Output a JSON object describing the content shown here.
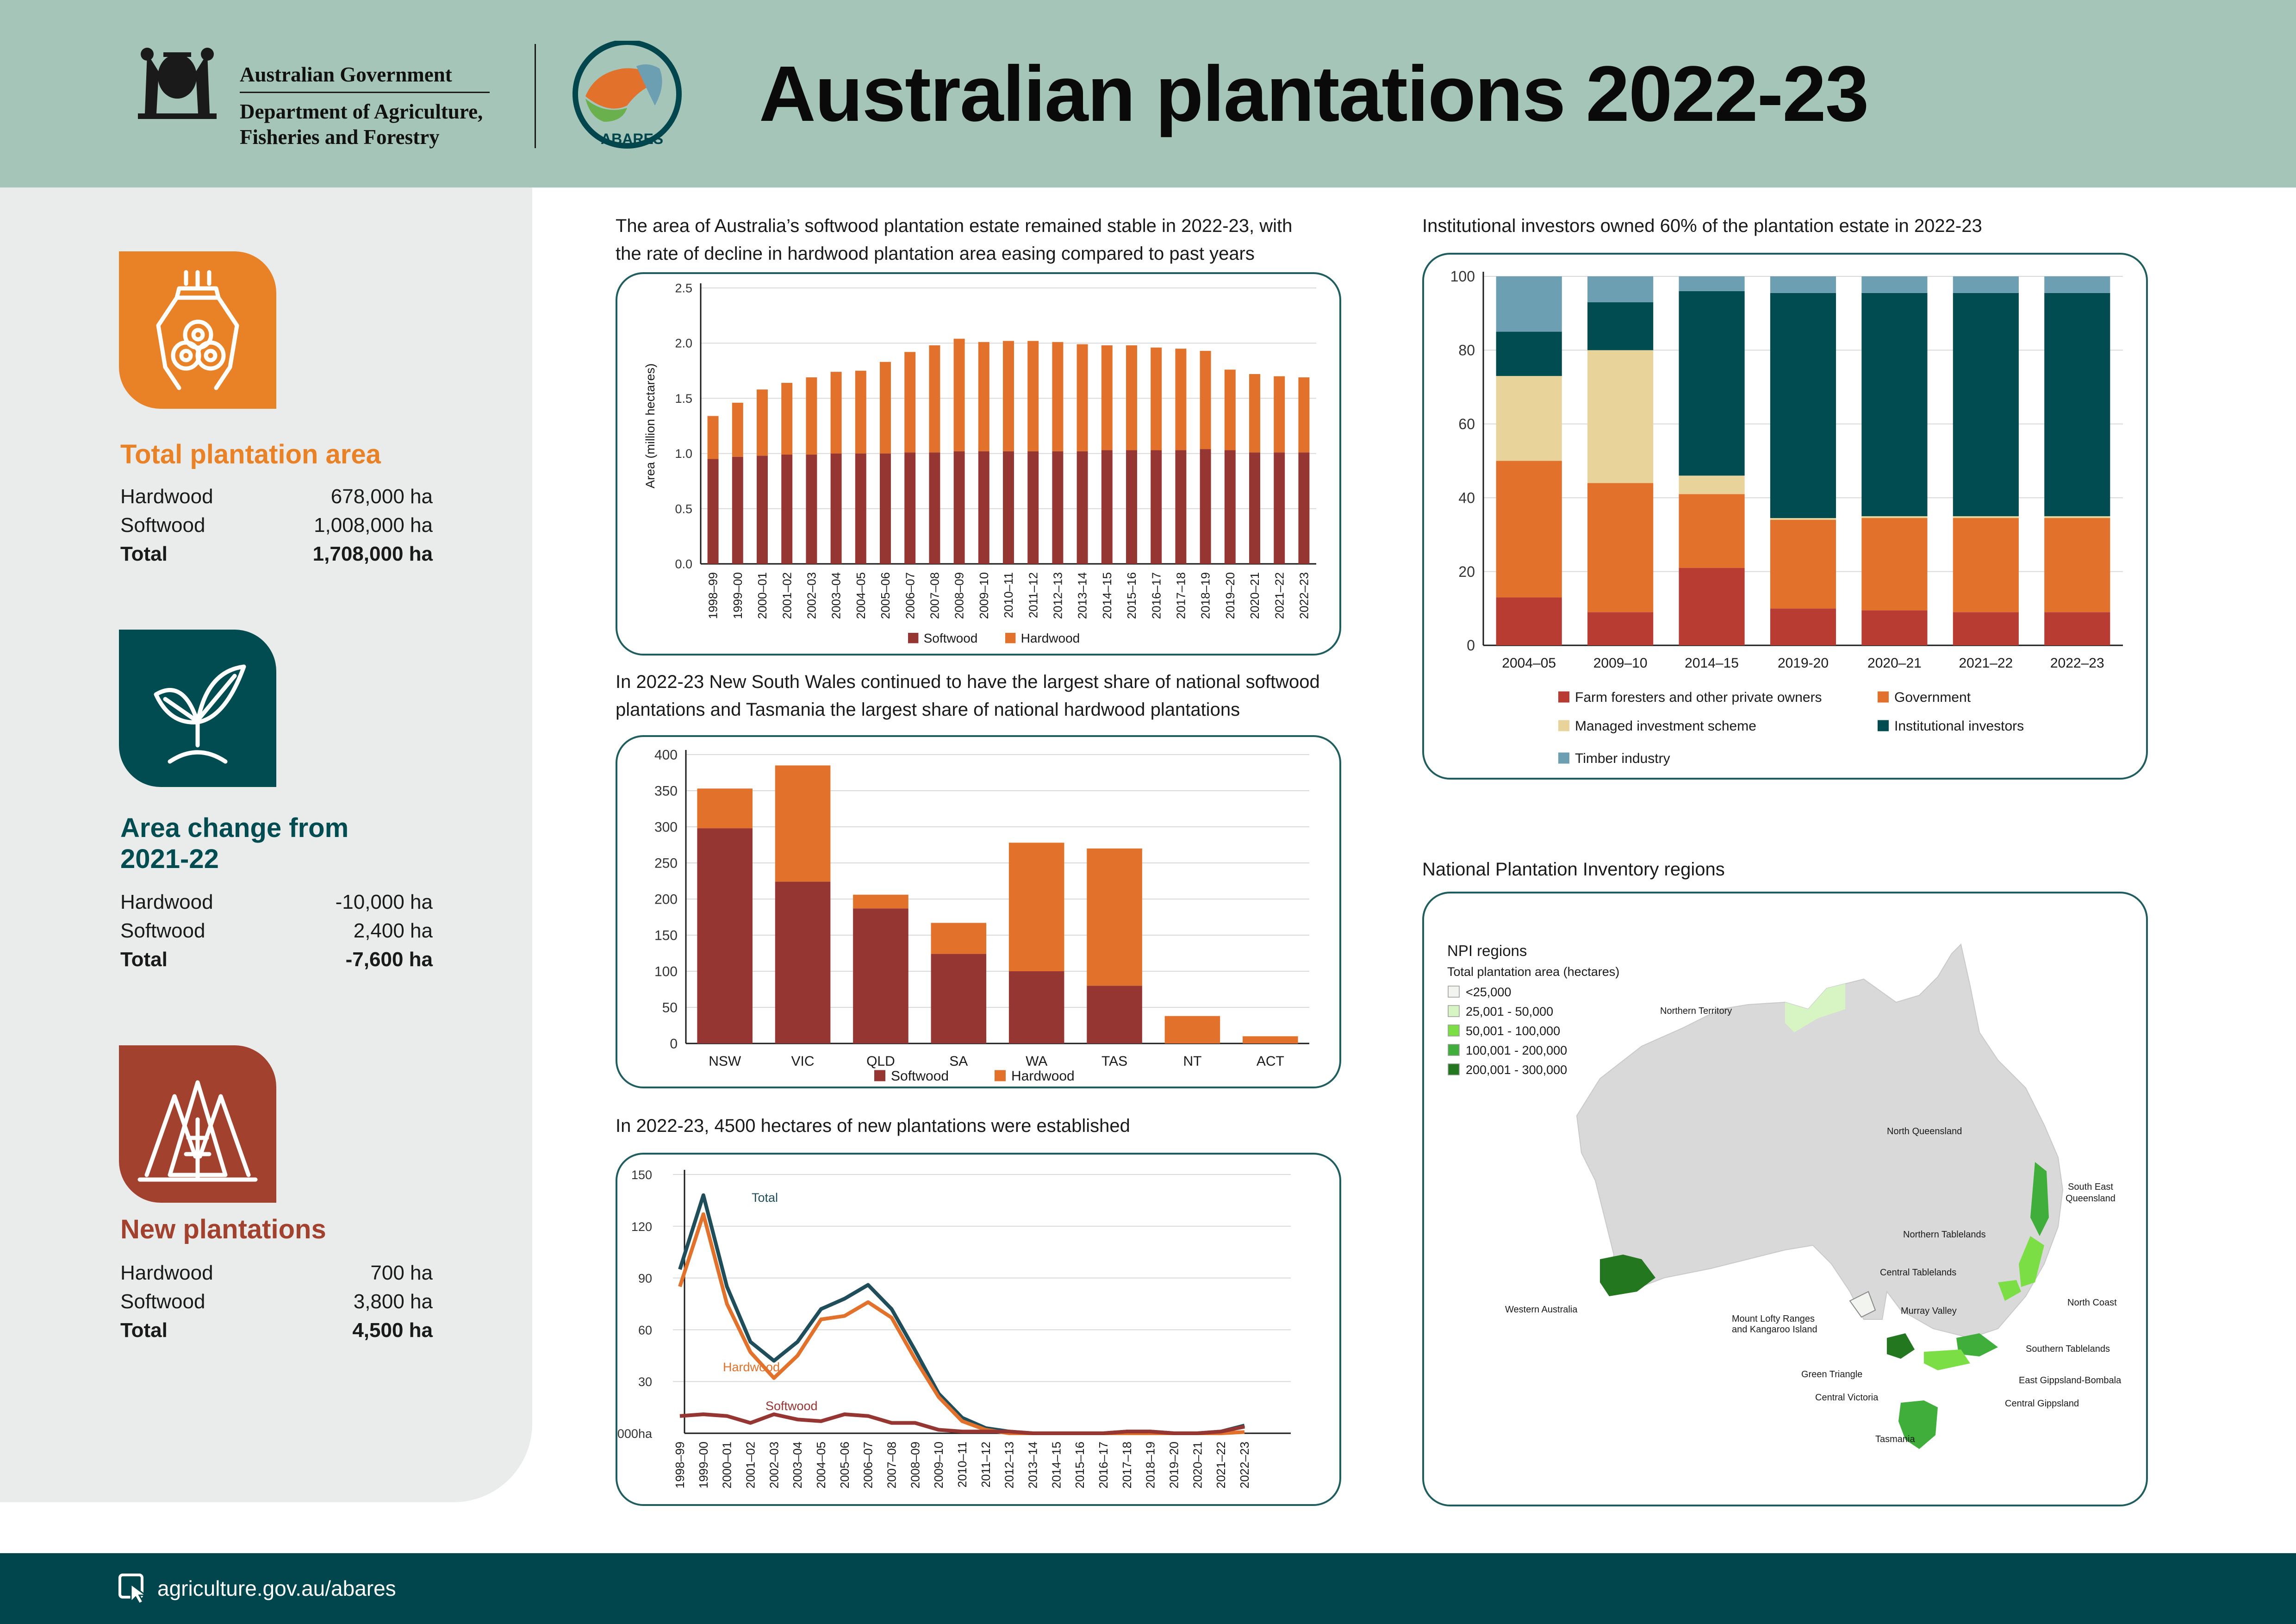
{
  "header": {
    "gov_line1": "Australian Government",
    "gov_line2": "Department of Agriculture,",
    "gov_line3": "Fisheries and Forestry",
    "abares_label": "ABARES",
    "title": "Australian plantations 2022-23"
  },
  "sidebar": {
    "total_area": {
      "heading": "Total plantation area",
      "rows": [
        {
          "label": "Hardwood",
          "value": "678,000 ha"
        },
        {
          "label": "Softwood",
          "value": "1,008,000 ha"
        },
        {
          "label": "Total",
          "value": "1,708,000 ha"
        }
      ]
    },
    "area_change": {
      "heading_line1": "Area change from",
      "heading_line2": "2021-22",
      "rows": [
        {
          "label": "Hardwood",
          "value": "-10,000 ha"
        },
        {
          "label": "Softwood",
          "value": "2,400 ha"
        },
        {
          "label": "Total",
          "value": "-7,600 ha"
        }
      ]
    },
    "new_plantations": {
      "heading": "New plantations",
      "rows": [
        {
          "label": "Hardwood",
          "value": "700 ha"
        },
        {
          "label": "Softwood",
          "value": "3,800 ha"
        },
        {
          "label": "Total",
          "value": "4,500 ha"
        }
      ]
    }
  },
  "captions": {
    "chart1_line1": "The area of Australia’s softwood plantation estate remained stable in 2022-23, with",
    "chart1_line2": "the rate of decline in hardwood plantation area easing compared to past years",
    "chart2_line1": "In 2022-23 New South Wales continued to have the largest share of national softwood",
    "chart2_line2": "plantations and Tasmania the largest share of national hardwood plantations",
    "chart3": "In 2022-23, 4500 hectares of new plantations were established",
    "chart4": "Institutional investors owned 60% of the plantation estate in 2022-23",
    "map": "National Plantation Inventory regions"
  },
  "colors": {
    "softwood": "#963633",
    "hardwood": "#e2712b",
    "teal": "#00464c",
    "total_line": "#1f4e5a",
    "farm": "#b83c32",
    "government": "#e2712b",
    "mis": "#e8d49a",
    "institutional": "#004c51",
    "timber": "#6d9fb3",
    "header_bg": "#a6c5b9",
    "sidebar_bg": "#e9ecea"
  },
  "chart_data": [
    {
      "type": "bar",
      "stacked": true,
      "categories": [
        "1998–99",
        "1999–00",
        "2000–01",
        "2001–02",
        "2002–03",
        "2003–04",
        "2004–05",
        "2005–06",
        "2006–07",
        "2007–08",
        "2008–09",
        "2009–10",
        "2010–11",
        "2011–12",
        "2012–13",
        "2013–14",
        "2014–15",
        "2015–16",
        "2016–17",
        "2017–18",
        "2018–19",
        "2019–20",
        "2020–21",
        "2021–22",
        "2022–23"
      ],
      "series": [
        {
          "name": "Softwood",
          "values": [
            0.95,
            0.97,
            0.98,
            0.99,
            0.99,
            1.0,
            1.0,
            1.0,
            1.01,
            1.01,
            1.02,
            1.02,
            1.02,
            1.02,
            1.02,
            1.02,
            1.03,
            1.03,
            1.03,
            1.03,
            1.04,
            1.03,
            1.01,
            1.01,
            1.01
          ]
        },
        {
          "name": "Hardwood",
          "values": [
            0.39,
            0.49,
            0.6,
            0.65,
            0.7,
            0.74,
            0.75,
            0.83,
            0.91,
            0.97,
            1.02,
            0.99,
            1.0,
            1.0,
            0.99,
            0.97,
            0.95,
            0.95,
            0.93,
            0.92,
            0.89,
            0.73,
            0.71,
            0.69,
            0.68
          ]
        }
      ],
      "ylabel": "Area (million hectares)",
      "yticks": [
        "0.0",
        "0.5",
        "1.0",
        "1.5",
        "2.0",
        "2.5"
      ],
      "ylim": [
        0,
        2.5
      ],
      "grid": true,
      "legend": "bottom"
    },
    {
      "type": "bar",
      "stacked": true,
      "categories": [
        "NSW",
        "VIC",
        "QLD",
        "SA",
        "WA",
        "TAS",
        "NT",
        "ACT"
      ],
      "series": [
        {
          "name": "Softwood",
          "values": [
            298,
            224,
            187,
            124,
            100,
            80,
            0,
            0
          ]
        },
        {
          "name": "Hardwood",
          "values": [
            55,
            161,
            19,
            43,
            178,
            190,
            38,
            10
          ]
        }
      ],
      "yticks": [
        "0",
        "50",
        "100",
        "150",
        "200",
        "250",
        "300",
        "350",
        "400"
      ],
      "ylim": [
        0,
        400
      ],
      "grid": true,
      "legend": "bottom"
    },
    {
      "type": "line",
      "x": [
        "1998–99",
        "1999–00",
        "2000–01",
        "2001–02",
        "2002–03",
        "2003–04",
        "2004–05",
        "2005–06",
        "2006–07",
        "2007–08",
        "2008–09",
        "2009–10",
        "2010–11",
        "2011–12",
        "2012–13",
        "2013–14",
        "2014–15",
        "2015–16",
        "2016–17",
        "2017–18",
        "2018–19",
        "2019–20",
        "2020–21",
        "2021–22",
        "2022–23"
      ],
      "series": [
        {
          "name": "Total",
          "values": [
            95,
            138,
            85,
            53,
            42,
            53,
            72,
            78,
            86,
            72,
            48,
            23,
            9,
            3,
            1,
            0,
            0,
            0,
            0,
            1,
            1,
            0,
            0,
            1,
            4.5
          ]
        },
        {
          "name": "Hardwood",
          "values": [
            85,
            127,
            75,
            47,
            32,
            45,
            66,
            68,
            76,
            67,
            43,
            21,
            7,
            2,
            0,
            0,
            0,
            0,
            0,
            0,
            0,
            0,
            0,
            0,
            0.7
          ]
        },
        {
          "name": "Softwood",
          "values": [
            10,
            11,
            10,
            6,
            11,
            8,
            7,
            11,
            10,
            6,
            6,
            2,
            1,
            1,
            1,
            0,
            0,
            0,
            0,
            1,
            1,
            0,
            0,
            1,
            3.8
          ]
        }
      ],
      "yticks": [
        "30",
        "60",
        "90",
        "120",
        "150"
      ],
      "yunit": "'000ha",
      "ylim": [
        0,
        150
      ],
      "grid": true
    },
    {
      "type": "bar",
      "stacked": true,
      "categories": [
        "2004–05",
        "2009–10",
        "2014–15",
        "2019-20",
        "2020–21",
        "2021–22",
        "2022–23"
      ],
      "series": [
        {
          "name": "Farm foresters and other private owners",
          "values": [
            13,
            9,
            21,
            10,
            9.5,
            9,
            9
          ]
        },
        {
          "name": "Government",
          "values": [
            37,
            35,
            20,
            24,
            25,
            25.5,
            25.5
          ]
        },
        {
          "name": "Managed investment scheme",
          "values": [
            23,
            36,
            5,
            0.5,
            0.5,
            0.5,
            0.5
          ]
        },
        {
          "name": "Institutional investors",
          "values": [
            12,
            13,
            50,
            61,
            60.5,
            60.5,
            60.5
          ]
        },
        {
          "name": "Timber industry",
          "values": [
            15,
            7,
            4,
            4.5,
            4.5,
            4.5,
            4.5
          ]
        }
      ],
      "yticks": [
        "0",
        "20",
        "40",
        "60",
        "80",
        "100"
      ],
      "ylim": [
        0,
        100
      ],
      "grid": true,
      "legend": "bottom"
    }
  ],
  "map": {
    "legend_title": "NPI regions",
    "legend_subtitle": "Total plantation area (hectares)",
    "legend_items": [
      {
        "label": "<25,000",
        "color": "#f1f4ef"
      },
      {
        "label": "25,001 - 50,000",
        "color": "#d6f5c3"
      },
      {
        "label": "50,001 - 100,000",
        "color": "#7bde45"
      },
      {
        "label": "100,001 - 200,000",
        "color": "#3fae3a"
      },
      {
        "label": "200,001 - 300,000",
        "color": "#23771f"
      }
    ],
    "regions": {
      "nt": "Northern Territory",
      "nq": "North Queensland",
      "seq_1": "South East",
      "seq_2": "Queensland",
      "ntab": "Northern Tablelands",
      "ctab": "Central Tablelands",
      "ncoast": "North Coast",
      "wa": "Western Australia",
      "mlr_1": "Mount Lofty Ranges",
      "mlr_2": "and Kangaroo Island",
      "mv": "Murray Valley",
      "stab": "Southern Tablelands",
      "gt": "Green Triangle",
      "egb": "East Gippsland-Bombala",
      "cv": "Central Victoria",
      "cg": "Central Gippsland",
      "tas": "Tasmania"
    }
  },
  "footer": {
    "url": "agriculture.gov.au/abares"
  }
}
